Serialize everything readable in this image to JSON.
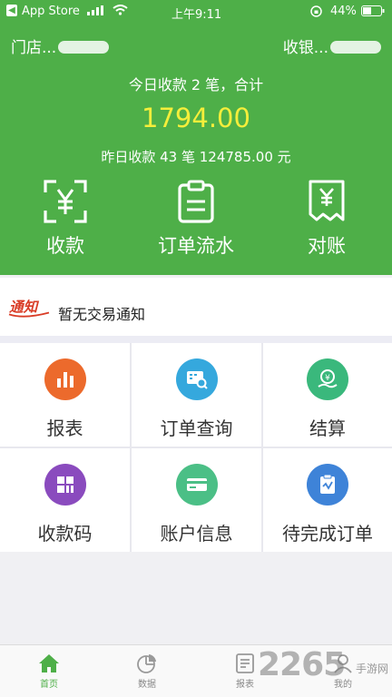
{
  "status_bar": {
    "back_app": "App Store",
    "time": "上午9:11",
    "battery": "44%"
  },
  "header": {
    "store_label": "门店...",
    "cashier_label": "收银...",
    "today_summary": "今日收款 2 笔，合计",
    "today_total": "1794.00",
    "yesterday_summary": "昨日收款 43 笔 124785.00 元",
    "colors": {
      "background": "#4eaf48",
      "total": "#f4ee3b"
    }
  },
  "quick_actions": [
    {
      "label": "收款",
      "icon": "scan-yuan-icon"
    },
    {
      "label": "订单流水",
      "icon": "clipboard-icon"
    },
    {
      "label": "对账",
      "icon": "receipt-yuan-icon"
    }
  ],
  "notice": {
    "badge": "通知",
    "text": "暂无交易通知"
  },
  "menu": [
    {
      "label": "报表",
      "icon": "bar-chart-icon",
      "color": "#ec6a2c"
    },
    {
      "label": "订单查询",
      "icon": "order-search-icon",
      "color": "#35a8dd"
    },
    {
      "label": "结算",
      "icon": "settlement-icon",
      "color": "#3ab87c"
    },
    {
      "label": "收款码",
      "icon": "qr-grid-icon",
      "color": "#8a4bbe"
    },
    {
      "label": "账户信息",
      "icon": "card-icon",
      "color": "#4bbf86"
    },
    {
      "label": "待完成订单",
      "icon": "pending-order-icon",
      "color": "#3e83d8"
    }
  ],
  "tabbar": [
    {
      "label": "首页",
      "icon": "home-icon",
      "active": true
    },
    {
      "label": "数据",
      "icon": "pie-chart-icon",
      "active": false
    },
    {
      "label": "报表",
      "icon": "report-icon",
      "active": false
    },
    {
      "label": "我的",
      "icon": "user-icon",
      "active": false
    }
  ],
  "watermark": {
    "number": "2265",
    "site": "手游网"
  }
}
